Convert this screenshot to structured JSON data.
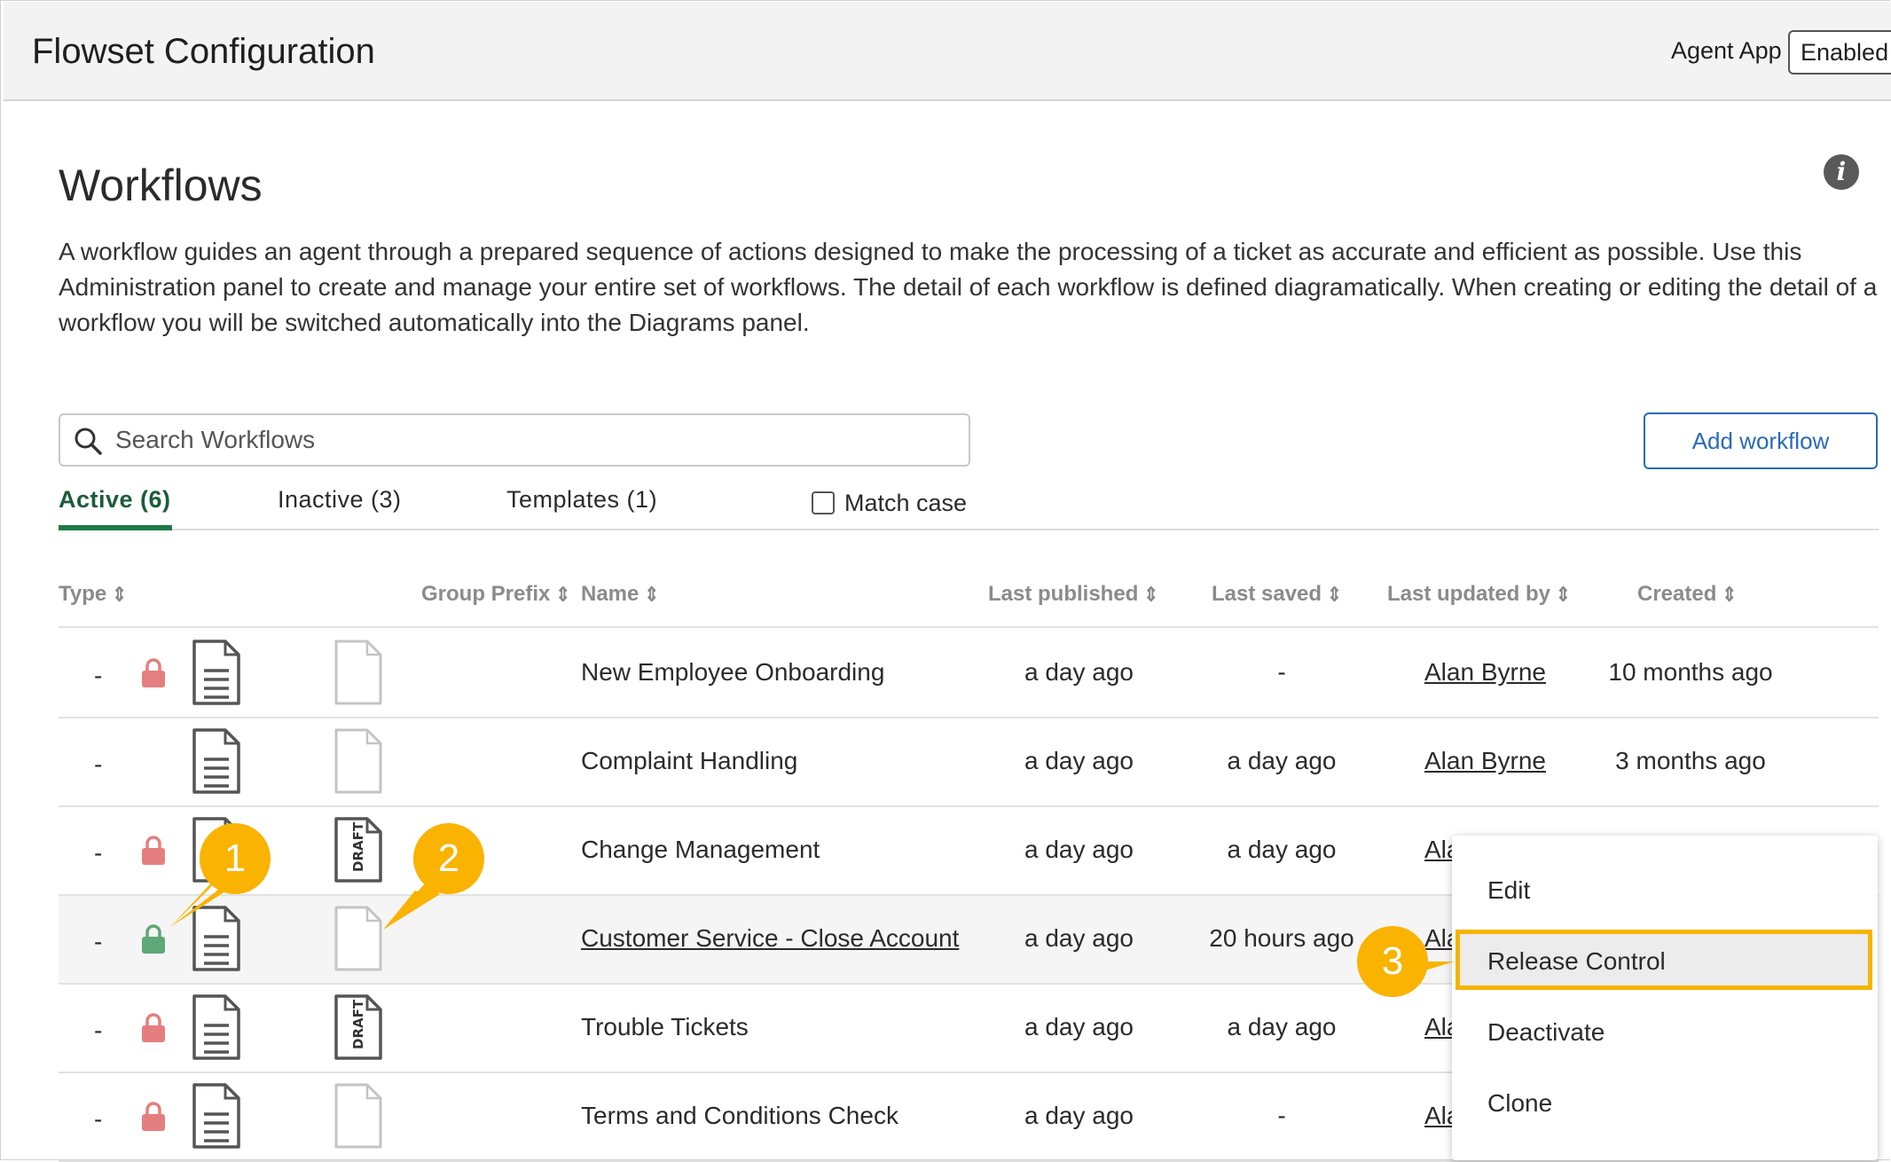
{
  "header": {
    "title": "Flowset Configuration",
    "agent_app_label": "Agent App",
    "agent_app_value": "Enabled"
  },
  "page": {
    "title": "Workflows",
    "description": "A workflow guides an agent through a prepared sequence of actions designed to make the processing of a ticket as accurate and efficient as possible. Use this Administration panel to create and manage your entire set of workflows. The detail of each workflow is defined diagramatically. When creating or editing the detail of a workflow you will be switched automatically into the Diagrams panel."
  },
  "search": {
    "placeholder": "Search Workflows"
  },
  "add_button": "Add workflow",
  "tabs": [
    {
      "label": "Active (6)"
    },
    {
      "label": "Inactive (3)"
    },
    {
      "label": "Templates (1)"
    }
  ],
  "match_case": "Match case",
  "columns": {
    "type": "Type",
    "group_prefix": "Group Prefix",
    "name": "Name",
    "last_published": "Last published",
    "last_saved": "Last saved",
    "last_updated_by": "Last updated by",
    "created": "Created"
  },
  "rows": [
    {
      "dash": "-",
      "locked": "red",
      "draft": false,
      "name": "New Employee Onboarding",
      "last_published": "a day ago",
      "last_saved": "-",
      "updated_by": "Alan Byrne",
      "created": "10 months ago"
    },
    {
      "dash": "-",
      "locked": "none",
      "draft": false,
      "name": "Complaint Handling",
      "last_published": "a day ago",
      "last_saved": "a day ago",
      "updated_by": "Alan Byrne",
      "created": "3 months ago"
    },
    {
      "dash": "-",
      "locked": "red",
      "draft": true,
      "name": "Change Management",
      "last_published": "a day ago",
      "last_saved": "a day ago",
      "updated_by": "Ala",
      "created": ""
    },
    {
      "dash": "-",
      "locked": "green",
      "draft": false,
      "name": "Customer Service - Close Account",
      "last_published": "a day ago",
      "last_saved": "20 hours ago",
      "updated_by": "Ala",
      "created": ""
    },
    {
      "dash": "-",
      "locked": "red",
      "draft": true,
      "name": "Trouble Tickets",
      "last_published": "a day ago",
      "last_saved": "a day ago",
      "updated_by": "Ala",
      "created": ""
    },
    {
      "dash": "-",
      "locked": "red",
      "draft": false,
      "name": "Terms and Conditions Check",
      "last_published": "a day ago",
      "last_saved": "-",
      "updated_by": "Ala",
      "created": ""
    }
  ],
  "context_menu": {
    "items": [
      {
        "label": "Edit"
      },
      {
        "label": "Release Control"
      },
      {
        "label": "Deactivate"
      },
      {
        "label": "Clone"
      }
    ]
  },
  "callouts": [
    "1",
    "2",
    "3"
  ],
  "colors": {
    "lock_red": "#e57f7f",
    "lock_green": "#5fa878",
    "accent_green": "#1f7a4a",
    "link_blue": "#2a6bb8",
    "callout": "#f9b300"
  },
  "draft_stamp": "DRAFT"
}
